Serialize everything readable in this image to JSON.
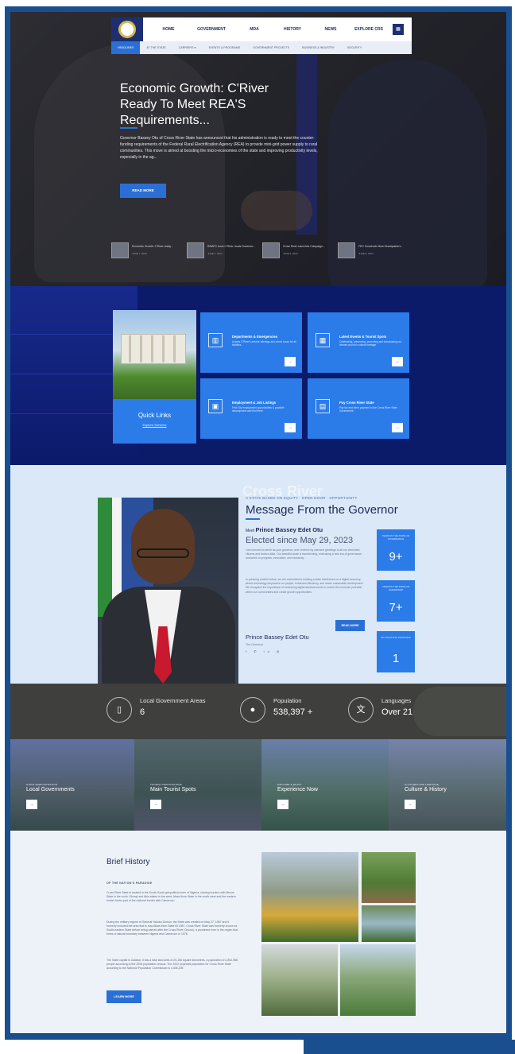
{
  "nav": {
    "top_items": [
      "HOME",
      "GOVERNMENT",
      "MDA",
      "HISTORY",
      "NEWS",
      "EXPLORE CRS"
    ],
    "sub_items": [
      "HEADLINES",
      "AT THE STATE",
      "CARRIERS ●",
      "EVENTS & PROGRAMS",
      "GOVERNMENT PROJECTS",
      "BUSINESS & INDUSTRY",
      "SECURITY"
    ]
  },
  "hero": {
    "title": "Economic Growth: C'River Ready To Meet REA'S Requirements...",
    "description": "Governor Bassey Otu of Cross River State has announced that his administration is ready to meet the counter-funding requirements of the Federal Rural Electrification Agency (REA) to provide mini-grid power supply to rural communities. This move is aimed at boosting the micro-economies of the state and improving productivity levels, especially in the ag...",
    "read_more": "READ MORE",
    "thumbnails": [
      {
        "title": "Economic Growth: C'River ready...",
        "date": "JUNE 7, 2024"
      },
      {
        "title": "RMAFC tours C'River, lauds Governor...",
        "date": "JUNE 7, 2024"
      },
      {
        "title": "Cross River Launches Campaign...",
        "date": "JUNE 6, 2024"
      },
      {
        "title": "FEC Constructs New Headquarters...",
        "date": "JUNE 6, 2024"
      }
    ]
  },
  "quick_links": {
    "title": "Quick Links",
    "subtitle": "Explore Services",
    "cards": [
      {
        "title": "Departments & Emergencies",
        "desc": "Access C'River's service offerings and check hours for all facilities.",
        "icon": "building-icon"
      },
      {
        "title": "Latest Events & Tourist Spots",
        "desc": "Celebrating, preserving, promoting and showcasing our diverse and rich cultural heritage.",
        "icon": "calendar-icon"
      },
      {
        "title": "Employment & Job Listings",
        "desc": "Find City employment opportunities & possible development and find there.",
        "icon": "briefcase-icon"
      },
      {
        "title": "Pay Cross River State",
        "desc": "Pay tax and other payment to the Cross River State Government.",
        "icon": "wallet-icon"
      }
    ]
  },
  "governor": {
    "watermark": "Cross River",
    "tagline": "A STATE BASED ON EQUITY · OPEN DOOR · OPPORTUNITY",
    "heading": "Message From the Governor",
    "meet_prefix": "Meet",
    "name_bold": "Prince Bassey Edet Otu",
    "elected": "Elected since May 29, 2023",
    "paragraphs": [
      "I am honored to serve as your governor, and I extend my warmest greetings to all our cherished citizens and visitors alike. Our beautiful state is transforming, embracing a new era of governance anchored on progress, innovation, and inclusivity.",
      "In pursuing a better future, we are committed to building a state that thrives on a digital economy, where technology empowers our people, enhances efficiency, and drives sustainable development. We recognize the importance of embracing digital advancements to unlock the immense potential within our communities and create growth opportunities."
    ],
    "read_more": "READ MORE",
    "signature_name": "Prince Bassey Edet Otu",
    "signature_role": "The Governor",
    "social": "f ✆ in ◎",
    "stats": [
      {
        "label": "YEARS IN THE STATE OF GOVERNANCE",
        "value": "9+"
      },
      {
        "label": "YEARS IN THE STATE OF LEADERSHIP",
        "value": "7+"
      },
      {
        "label": "NO. POLITICAL POSITIONS",
        "value": "1"
      }
    ]
  },
  "stats_bar": [
    {
      "icon": "map-icon",
      "label": "Local Government Areas",
      "value": "6"
    },
    {
      "icon": "people-icon",
      "label": "Population",
      "value": "538,397 +"
    },
    {
      "icon": "translate-icon",
      "label": "Languages",
      "value": "Over 21"
    }
  ],
  "categories": [
    {
      "kicker": "STATE ADMINISTRATION",
      "title": "Local Governments"
    },
    {
      "kicker": "TOURIST DESTINATIONS",
      "title": "Main Tourist Spots"
    },
    {
      "kicker": "EXPLORE & ENJOY",
      "title": "Experience Now"
    },
    {
      "kicker": "CULTURES AND HERITAGE",
      "title": "Culture & History"
    }
  ],
  "history": {
    "title": "Brief History",
    "kicker": "OF THE NATION'S PARADISE",
    "paragraphs": [
      "Cross River State is located in the South-South geopolitical zone of Nigeria, sharing borders with Benue State in the north, Ebonyi and Abia states in the west, Akwa Ibom State in the south-west and the eastern border forms part of the national border with Cameroon.",
      "During the military regime of General Yakubu Gowon, the State was created on May 27, 1967 and it formerly included the area that is now Akwa Ibom State till 1987. Cross River State was formerly known as South-eastern State before being named after the Cross River (Oyono), a prominent river in the region that forms a natural boundary between Nigeria and Cameroon in 1976.",
      "The State capital is Calabar. It has a total land area of 20,156 square kilometres, a population of 2,892,988 people according to the 2006 population census. The 2022 projected population for Cross River State according to the National Population Commission is 4,406,205."
    ],
    "button": "LEARN MORE"
  }
}
